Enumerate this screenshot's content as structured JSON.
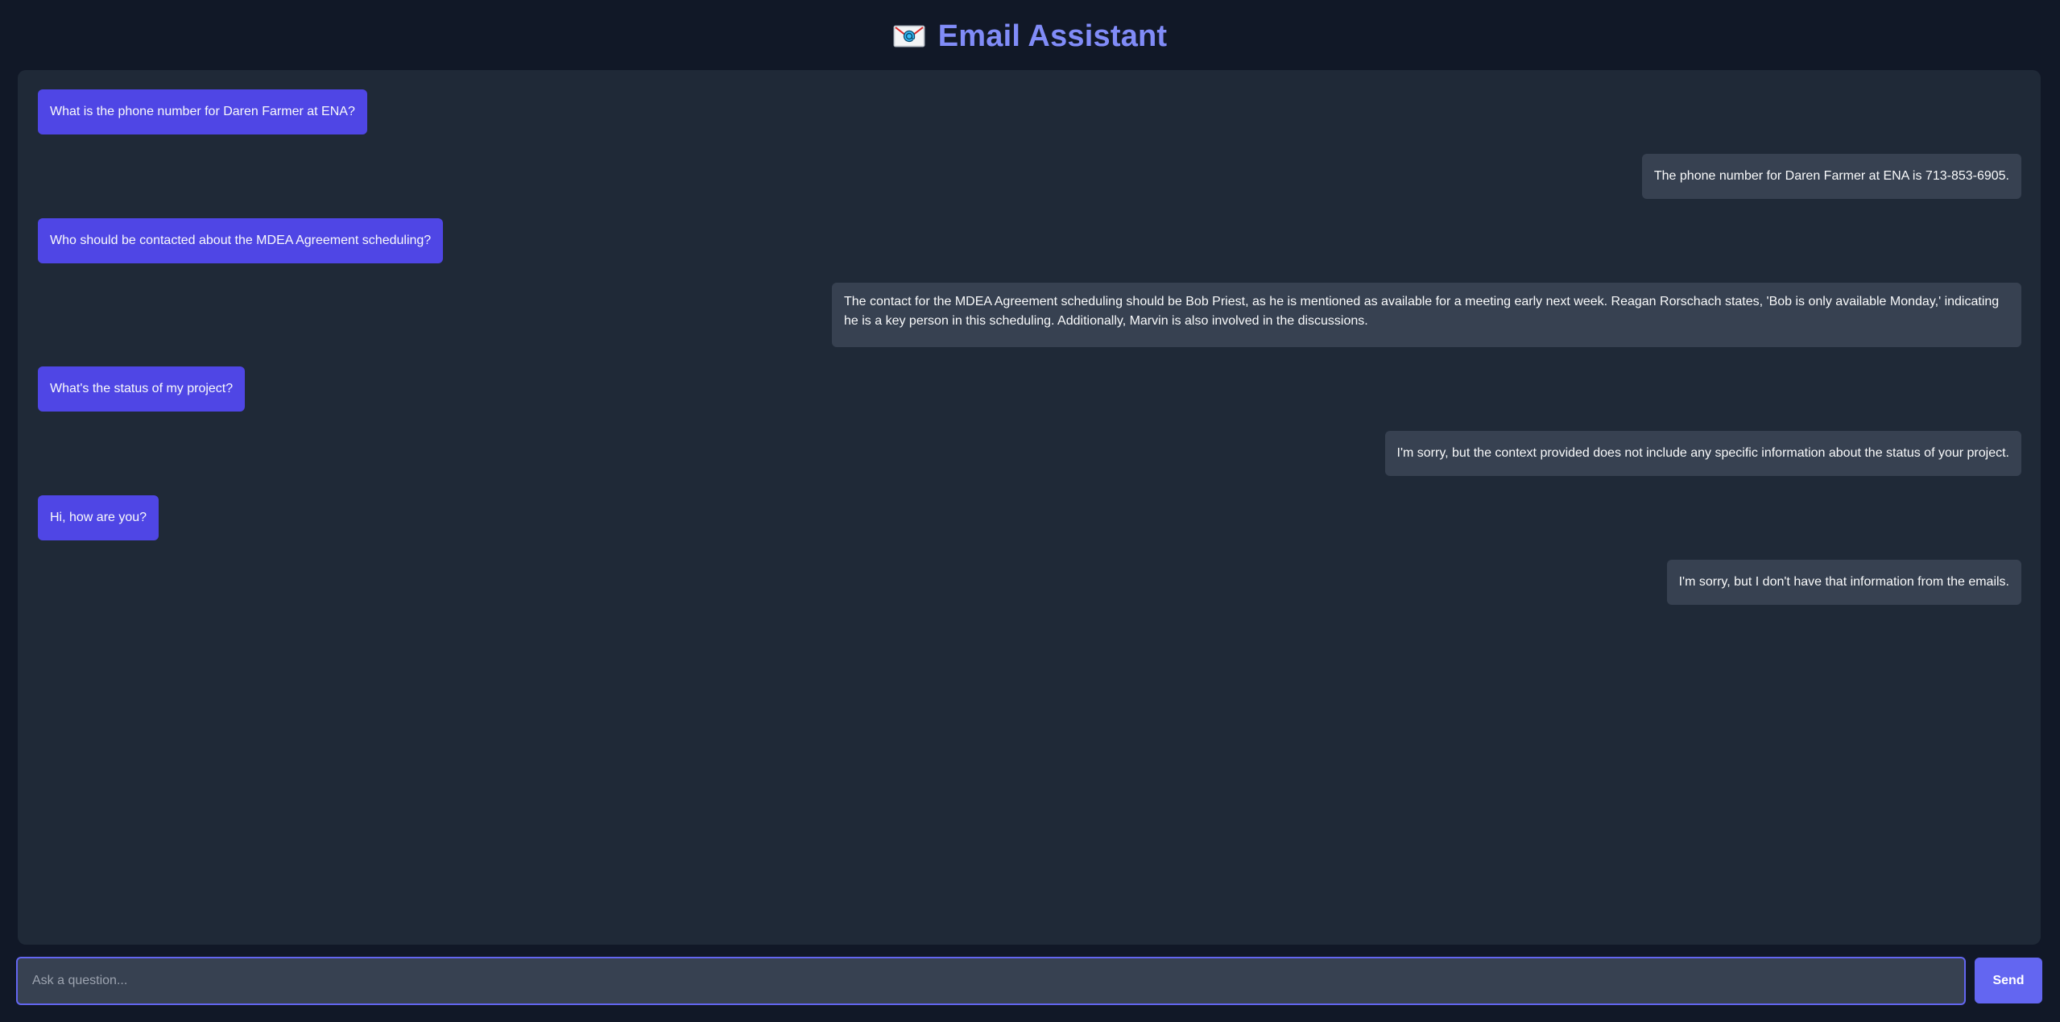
{
  "header": {
    "title": "Email Assistant",
    "icon": "envelope-icon"
  },
  "messages": [
    {
      "role": "user",
      "text": "What is the phone number for Daren Farmer at ENA?"
    },
    {
      "role": "assistant",
      "text": "The phone number for Daren Farmer at ENA is 713-853-6905."
    },
    {
      "role": "user",
      "text": "Who should be contacted about the MDEA Agreement scheduling?"
    },
    {
      "role": "assistant",
      "text": "The contact for the MDEA Agreement scheduling should be Bob Priest, as he is mentioned as available for a meeting early next week. Reagan Rorschach states, 'Bob is only available Monday,' indicating he is a key person in this scheduling. Additionally, Marvin is also involved in the discussions."
    },
    {
      "role": "user",
      "text": "What's the status of my project?"
    },
    {
      "role": "assistant",
      "text": "I'm sorry, but the context provided does not include any specific information about the status of your project."
    },
    {
      "role": "user",
      "text": "Hi, how are you?"
    },
    {
      "role": "assistant",
      "text": "I'm sorry, but I don't have that information from the emails."
    }
  ],
  "composer": {
    "placeholder": "Ask a question...",
    "value": "",
    "send_label": "Send"
  },
  "colors": {
    "page_background": "#111827",
    "panel_background": "#1f2937",
    "user_bubble": "#4f46e5",
    "assistant_bubble": "#374151",
    "accent": "#6366f1",
    "title": "#818cf8"
  }
}
